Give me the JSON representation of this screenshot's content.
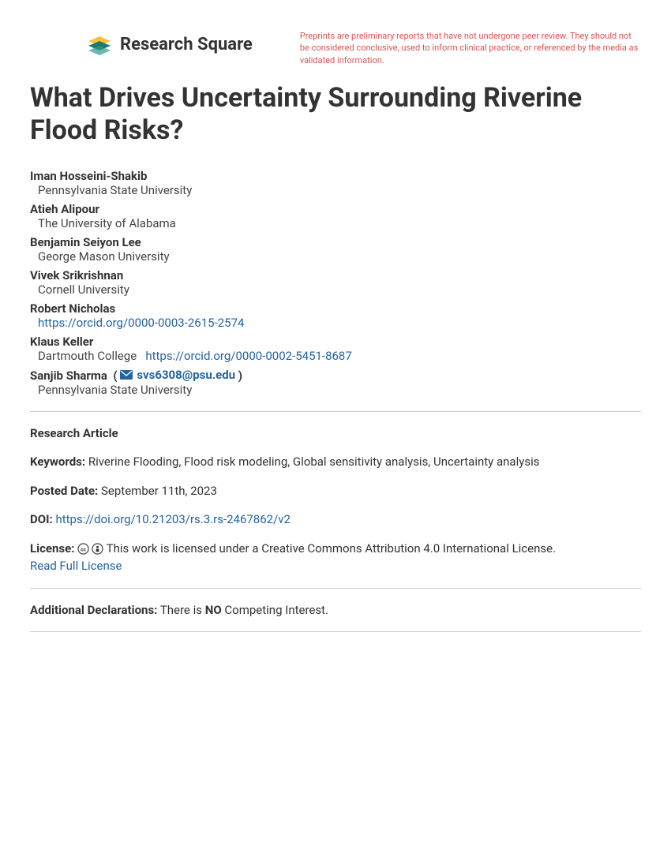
{
  "header": {
    "logo_text": "Research Square",
    "disclaimer": "Preprints are preliminary reports that have not undergone peer review. They should not be considered conclusive, used to inform clinical practice, or referenced by the media as validated information."
  },
  "title": "What Drives Uncertainty Surrounding Riverine Flood Risks?",
  "authors": [
    {
      "name": "Iman Hosseini-Shakib",
      "affiliation": "Pennsylvania State University"
    },
    {
      "name": "Atieh Alipour",
      "affiliation": "The University of Alabama"
    },
    {
      "name": "Benjamin Seiyon Lee",
      "affiliation": "George Mason University"
    },
    {
      "name": "Vivek Srikrishnan",
      "affiliation": "Cornell University"
    },
    {
      "name": "Robert Nicholas",
      "orcid": "https://orcid.org/0000-0003-2615-2574"
    },
    {
      "name": "Klaus Keller",
      "affiliation": "Dartmouth College",
      "orcid": "https://orcid.org/0000-0002-5451-8687"
    },
    {
      "name": "Sanjib Sharma",
      "email": "svs6308@psu.edu",
      "affiliation": "Pennsylvania State University"
    }
  ],
  "meta": {
    "article_type": "Research Article",
    "keywords_label": "Keywords:",
    "keywords": "Riverine Flooding, Flood risk modeling, Global sensitivity analysis, Uncertainty analysis",
    "posted_label": "Posted Date:",
    "posted_date": "September 11th, 2023",
    "doi_label": "DOI:",
    "doi": "https://doi.org/10.21203/rs.3.rs-2467862/v2",
    "license_label": "License:",
    "license_text": "This work is licensed under a Creative Commons Attribution 4.0 International License.",
    "license_link": "Read Full License",
    "declarations_label": "Additional Declarations:",
    "declarations_prefix": "There is",
    "declarations_no": "NO",
    "declarations_suffix": "Competing Interest."
  }
}
